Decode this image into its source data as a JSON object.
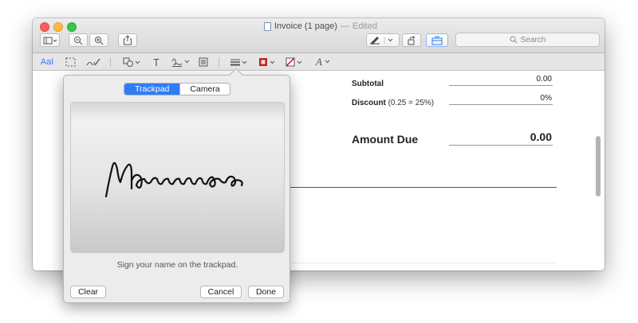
{
  "window": {
    "title": "Invoice (1 page)",
    "title_separator": "—",
    "title_status": "Edited"
  },
  "toolbar": {
    "search_placeholder": "Search"
  },
  "markup_toolbar": {
    "text_style_label": "AaI",
    "text_tool_label": "T",
    "font_label": "A"
  },
  "document": {
    "subtotal_label": "Subtotal",
    "subtotal_value": "0.00",
    "discount_label": "Discount",
    "discount_note": "(0.25 = 25%)",
    "discount_value": "0%",
    "amount_due_label": "Amount Due",
    "amount_due_value": "0.00"
  },
  "signature_popover": {
    "tabs": [
      {
        "label": "Trackpad",
        "selected": true
      },
      {
        "label": "Camera",
        "selected": false
      }
    ],
    "hint": "Sign your name on the trackpad.",
    "clear_label": "Clear",
    "cancel_label": "Cancel",
    "done_label": "Done"
  },
  "colors": {
    "accent": "#2f7df6",
    "close": "#fc605c",
    "minimize": "#fdbc40",
    "maximize": "#34c84a"
  }
}
